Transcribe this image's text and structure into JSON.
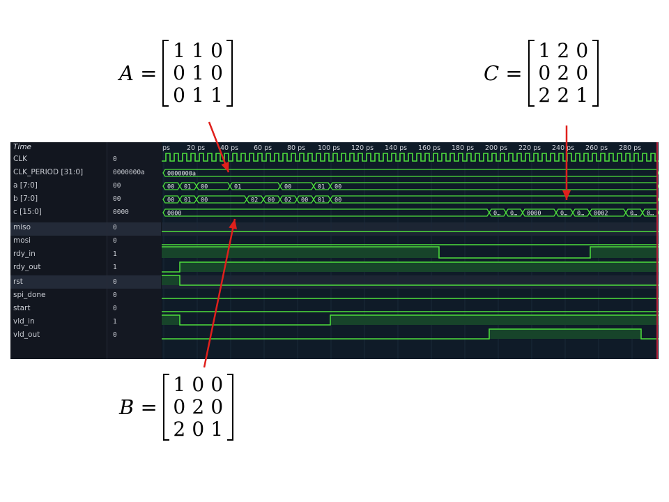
{
  "matrices": {
    "A": {
      "name": "A",
      "rows": [
        [
          "1",
          "1",
          "0"
        ],
        [
          "0",
          "1",
          "0"
        ],
        [
          "0",
          "1",
          "1"
        ]
      ]
    },
    "B": {
      "name": "B",
      "rows": [
        [
          "1",
          "0",
          "0"
        ],
        [
          "0",
          "2",
          "0"
        ],
        [
          "2",
          "0",
          "1"
        ]
      ]
    },
    "C": {
      "name": "C",
      "rows": [
        [
          "1",
          "2",
          "0"
        ],
        [
          "0",
          "2",
          "0"
        ],
        [
          "2",
          "2",
          "1"
        ]
      ]
    }
  },
  "viewer": {
    "time_header": "Time",
    "timescale": {
      "start_label": "ps",
      "labels": [
        "20 ps",
        "40 ps",
        "60 ps",
        "80 ps",
        "100 ps",
        "120 ps",
        "140 ps",
        "160 ps",
        "180 ps",
        "200 ps",
        "220 ps",
        "240 ps",
        "260 ps",
        "280 ps"
      ]
    },
    "signals": [
      {
        "name": "CLK",
        "value": "0"
      },
      {
        "name": "CLK_PERIOD [31:0]",
        "value": "0000000a"
      },
      {
        "name": "a [7:0]",
        "value": "00"
      },
      {
        "name": "b [7:0]",
        "value": "00"
      },
      {
        "name": "c [15:0]",
        "value": "0000"
      },
      {
        "name": "miso",
        "value": "0"
      },
      {
        "name": "mosi",
        "value": "0"
      },
      {
        "name": "rdy_in",
        "value": "1"
      },
      {
        "name": "rdy_out",
        "value": "1"
      },
      {
        "name": "rst",
        "value": "0"
      },
      {
        "name": "spi_done",
        "value": "0"
      },
      {
        "name": "start",
        "value": "0"
      },
      {
        "name": "vld_in",
        "value": "1"
      },
      {
        "name": "vld_out",
        "value": "0"
      }
    ],
    "bus_values": {
      "clk_period": [
        "0000000a"
      ],
      "a": [
        "00",
        "01",
        "00",
        "01",
        "00",
        "01",
        "00"
      ],
      "b": [
        "00",
        "01",
        "00",
        "02",
        "00",
        "02",
        "00",
        "01",
        "00"
      ],
      "c": [
        "0000",
        "0…",
        "0…",
        "0000",
        "0…",
        "0…",
        "0002",
        "0…",
        "0…"
      ]
    },
    "colors": {
      "wave": "#4ee03c",
      "fill": "#17442a",
      "cursor": "#b0203a",
      "arrow": "#e0201c"
    }
  }
}
